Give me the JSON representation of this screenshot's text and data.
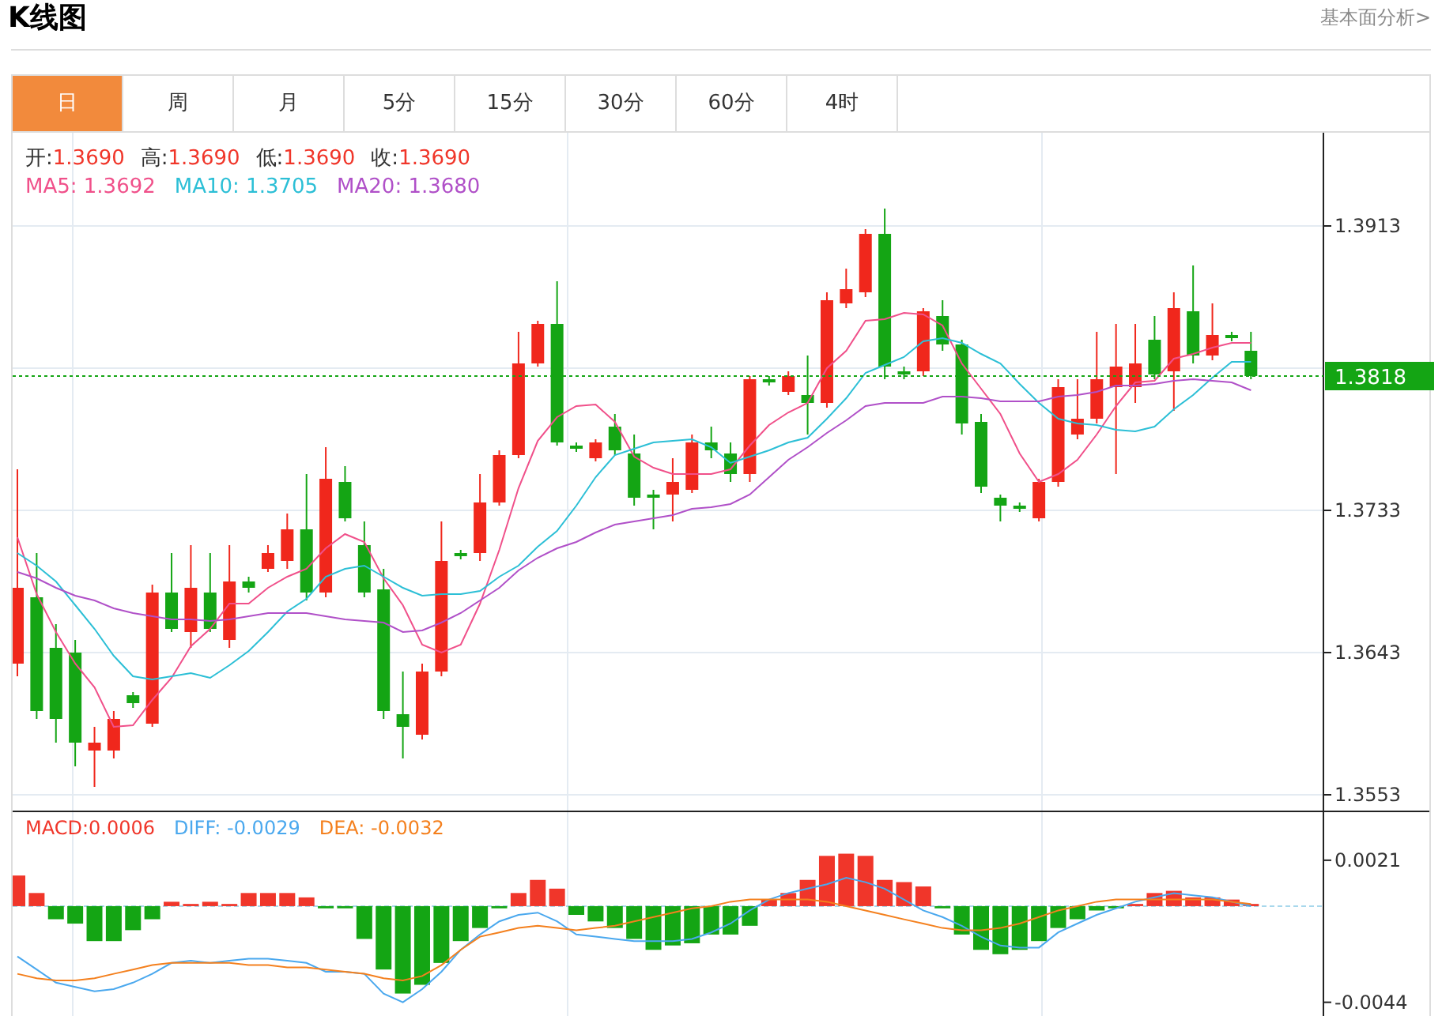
{
  "header": {
    "title": "K线图",
    "link": "基本面分析>"
  },
  "tabs": [
    {
      "label": "日",
      "selected": true
    },
    {
      "label": "周",
      "selected": false
    },
    {
      "label": "月",
      "selected": false
    },
    {
      "label": "5分",
      "selected": false
    },
    {
      "label": "15分",
      "selected": false
    },
    {
      "label": "30分",
      "selected": false
    },
    {
      "label": "60分",
      "selected": false
    },
    {
      "label": "4时",
      "selected": false
    }
  ],
  "quote": [
    {
      "label": "开:",
      "value": "1.3690"
    },
    {
      "label": "高:",
      "value": "1.3690"
    },
    {
      "label": "低:",
      "value": "1.3690"
    },
    {
      "label": "收:",
      "value": "1.3690"
    }
  ],
  "ma_legend": [
    {
      "label": "MA5: 1.3692",
      "color": "#f0508a"
    },
    {
      "label": "MA10: 1.3705",
      "color": "#2cbfd6"
    },
    {
      "label": "MA20: 1.3680",
      "color": "#b050c8"
    }
  ],
  "price_chart": {
    "chart_data": {
      "type": "candlestick",
      "categories": [
        null,
        null,
        null,
        null,
        null,
        null,
        null,
        null,
        null,
        null,
        null,
        null,
        null,
        null,
        null,
        null,
        null,
        null,
        null,
        null,
        null,
        null,
        null,
        null,
        null,
        null,
        null,
        null,
        null,
        null,
        null,
        null,
        null,
        null,
        null,
        null,
        null,
        null,
        null,
        null,
        null,
        null,
        null,
        null,
        null,
        null,
        null,
        null,
        null,
        null,
        null,
        null,
        null,
        null,
        null,
        null,
        null,
        null,
        null,
        null,
        null,
        null,
        null,
        null,
        null
      ],
      "yticks": [
        1.3913,
        1.3733,
        1.3643,
        1.3553
      ],
      "ylim": [
        1.3543,
        1.3972
      ],
      "grid": true,
      "ref_lines": [
        {
          "axis": "y",
          "value": 1.3818,
          "label": "1.3818",
          "color": "#14a514"
        }
      ],
      "ohlc": [
        [
          1.3636,
          1.3759,
          1.3628,
          1.3684
        ],
        [
          1.3678,
          1.3706,
          1.3601,
          1.3606
        ],
        [
          1.3646,
          1.3661,
          1.3586,
          1.3601
        ],
        [
          1.3643,
          1.3651,
          1.3571,
          1.3586
        ],
        [
          1.3581,
          1.3596,
          1.3558,
          1.3586
        ],
        [
          1.3581,
          1.3606,
          1.3576,
          1.3601
        ],
        [
          1.3616,
          1.3618,
          1.3608,
          1.3611
        ],
        [
          1.3598,
          1.3686,
          1.3596,
          1.3681
        ],
        [
          1.3681,
          1.3706,
          1.3656,
          1.3658
        ],
        [
          1.3656,
          1.3711,
          1.3646,
          1.3684
        ],
        [
          1.3681,
          1.3706,
          1.3656,
          1.3658
        ],
        [
          1.3651,
          1.3711,
          1.3646,
          1.3688
        ],
        [
          1.3688,
          1.3691,
          1.3681,
          1.3684
        ],
        [
          1.3696,
          1.3711,
          1.3694,
          1.3706
        ],
        [
          1.3701,
          1.3731,
          1.3696,
          1.3721
        ],
        [
          1.3721,
          1.3756,
          1.3676,
          1.3681
        ],
        [
          1.3681,
          1.3773,
          1.3678,
          1.3753
        ],
        [
          1.3751,
          1.3761,
          1.3726,
          1.3728
        ],
        [
          1.3711,
          1.3726,
          1.3678,
          1.3681
        ],
        [
          1.3683,
          1.3696,
          1.3601,
          1.3606
        ],
        [
          1.3604,
          1.3631,
          1.3576,
          1.3596
        ],
        [
          1.3591,
          1.3636,
          1.3588,
          1.3631
        ],
        [
          1.3631,
          1.3726,
          1.3628,
          1.3701
        ],
        [
          1.3706,
          1.3708,
          1.3702,
          1.3704
        ],
        [
          1.3706,
          1.3756,
          1.3701,
          1.3738
        ],
        [
          1.3738,
          1.3771,
          1.3736,
          1.3768
        ],
        [
          1.3768,
          1.3846,
          1.3766,
          1.3826
        ],
        [
          1.3826,
          1.3853,
          1.3824,
          1.3851
        ],
        [
          1.3851,
          1.3878,
          1.3774,
          1.3776
        ],
        [
          1.3774,
          1.3776,
          1.377,
          1.3772
        ],
        [
          1.3766,
          1.3778,
          1.3764,
          1.3776
        ],
        [
          1.3786,
          1.3794,
          1.3768,
          1.3771
        ],
        [
          1.3769,
          1.3781,
          1.3736,
          1.3741
        ],
        [
          1.3743,
          1.3746,
          1.3721,
          1.3741
        ],
        [
          1.3743,
          1.3766,
          1.3726,
          1.3751
        ],
        [
          1.3746,
          1.3781,
          1.3744,
          1.3776
        ],
        [
          1.3776,
          1.3786,
          1.3766,
          1.3771
        ],
        [
          1.3769,
          1.3776,
          1.3751,
          1.3756
        ],
        [
          1.3756,
          1.3818,
          1.3751,
          1.3816
        ],
        [
          1.3816,
          1.3818,
          1.3812,
          1.3814
        ],
        [
          1.3808,
          1.3821,
          1.3806,
          1.3818
        ],
        [
          1.3806,
          1.3831,
          1.3781,
          1.3801
        ],
        [
          1.3801,
          1.3871,
          1.3798,
          1.3866
        ],
        [
          1.3864,
          1.3886,
          1.3861,
          1.3873
        ],
        [
          1.3871,
          1.3911,
          1.3868,
          1.3908
        ],
        [
          1.3908,
          1.3924,
          1.3816,
          1.3824
        ],
        [
          1.3821,
          1.3824,
          1.3816,
          1.3819
        ],
        [
          1.3821,
          1.3861,
          1.3818,
          1.3859
        ],
        [
          1.3856,
          1.3866,
          1.3834,
          1.3838
        ],
        [
          1.3838,
          1.3841,
          1.3781,
          1.3788
        ],
        [
          1.3789,
          1.3794,
          1.3744,
          1.3748
        ],
        [
          1.3741,
          1.3743,
          1.3726,
          1.3736
        ],
        [
          1.3736,
          1.3738,
          1.3732,
          1.3734
        ],
        [
          1.3728,
          1.3753,
          1.3726,
          1.3751
        ],
        [
          1.3751,
          1.3816,
          1.3748,
          1.3811
        ],
        [
          1.3781,
          1.3816,
          1.3778,
          1.3791
        ],
        [
          1.3791,
          1.3846,
          1.3788,
          1.3816
        ],
        [
          1.3811,
          1.3851,
          1.3756,
          1.3824
        ],
        [
          1.3811,
          1.3851,
          1.3801,
          1.3826
        ],
        [
          1.3841,
          1.3856,
          1.3816,
          1.3819
        ],
        [
          1.3821,
          1.3871,
          1.3796,
          1.3861
        ],
        [
          1.3859,
          1.3888,
          1.3826,
          1.3831
        ],
        [
          1.3831,
          1.3864,
          1.3828,
          1.3844
        ],
        [
          1.3844,
          1.3846,
          1.384,
          1.3842
        ],
        [
          1.3834,
          1.3846,
          1.3816,
          1.3818
        ]
      ],
      "series": [
        {
          "type": "line",
          "color": "#f0508a",
          "values": [
            1.3716,
            1.368,
            1.3656,
            1.3636,
            1.3621,
            1.3596,
            1.3597,
            1.3613,
            1.3627,
            1.3647,
            1.3658,
            1.3674,
            1.3674,
            1.3684,
            1.3691,
            1.3696,
            1.3709,
            1.3718,
            1.3713,
            1.369,
            1.3673,
            1.3648,
            1.3643,
            1.3648,
            1.3674,
            1.3708,
            1.3747,
            1.3777,
            1.3792,
            1.3799,
            1.38,
            1.3789,
            1.3767,
            1.376,
            1.3756,
            1.3756,
            1.3756,
            1.3759,
            1.3774,
            1.3787,
            1.3795,
            1.3801,
            1.3823,
            1.3834,
            1.3853,
            1.3854,
            1.3858,
            1.3857,
            1.385,
            1.3826,
            1.381,
            1.3794,
            1.3769,
            1.3751,
            1.3756,
            1.3765,
            1.3781,
            1.3799,
            1.3814,
            1.3815,
            1.3829,
            1.3832,
            1.3836,
            1.3839,
            1.3839
          ]
        },
        {
          "type": "line",
          "color": "#2cbfd6",
          "values": [
            1.3706,
            1.3698,
            1.3688,
            1.3673,
            1.3658,
            1.3641,
            1.3628,
            1.3626,
            1.3628,
            1.363,
            1.3627,
            1.3635,
            1.3644,
            1.3656,
            1.3669,
            1.3677,
            1.3691,
            1.3696,
            1.3698,
            1.3691,
            1.3684,
            1.3679,
            1.368,
            1.368,
            1.3682,
            1.3691,
            1.3698,
            1.371,
            1.372,
            1.3736,
            1.3754,
            1.3768,
            1.3772,
            1.3776,
            1.3777,
            1.3778,
            1.3773,
            1.3763,
            1.3767,
            1.3771,
            1.3776,
            1.3779,
            1.3791,
            1.3804,
            1.382,
            1.3825,
            1.383,
            1.384,
            1.3842,
            1.3839,
            1.3832,
            1.3826,
            1.3813,
            1.3801,
            1.3791,
            1.3788,
            1.3787,
            1.3784,
            1.3783,
            1.3786,
            1.3797,
            1.3806,
            1.3817,
            1.3827,
            1.3827
          ]
        },
        {
          "type": "line",
          "color": "#b050c8",
          "values": [
            1.3694,
            1.369,
            1.3684,
            1.3679,
            1.3676,
            1.3671,
            1.3668,
            1.3666,
            1.3664,
            1.3664,
            1.3663,
            1.3664,
            1.3666,
            1.3668,
            1.3668,
            1.3668,
            1.3666,
            1.3664,
            1.3663,
            1.3662,
            1.3656,
            1.3657,
            1.3662,
            1.3668,
            1.3676,
            1.3684,
            1.3695,
            1.3703,
            1.3709,
            1.3713,
            1.3719,
            1.3724,
            1.3726,
            1.3728,
            1.373,
            1.3734,
            1.3735,
            1.3737,
            1.3743,
            1.3754,
            1.3765,
            1.3773,
            1.3782,
            1.379,
            1.3799,
            1.3801,
            1.3801,
            1.3801,
            1.3805,
            1.3805,
            1.3804,
            1.3802,
            1.3802,
            1.3802,
            1.3805,
            1.3806,
            1.3808,
            1.3812,
            1.3812,
            1.3813,
            1.3815,
            1.3816,
            1.3815,
            1.3814,
            1.3809
          ]
        }
      ]
    }
  },
  "macd_chart": {
    "legend": [
      {
        "label": "MACD:0.0006",
        "color": "#f0362a"
      },
      {
        "label": "DIFF: -0.0029",
        "color": "#4aa8ee"
      },
      {
        "label": "DEA: -0.0032",
        "color": "#f4801e"
      }
    ],
    "chart_data": {
      "type": "bar",
      "categories": [
        null,
        null,
        null,
        null,
        null,
        null,
        null,
        null,
        null,
        null,
        null,
        null,
        null,
        null,
        null,
        null,
        null,
        null,
        null,
        null,
        null,
        null,
        null,
        null,
        null,
        null,
        null,
        null,
        null,
        null,
        null,
        null,
        null,
        null,
        null,
        null,
        null,
        null,
        null,
        null,
        null,
        null,
        null,
        null,
        null,
        null,
        null,
        null,
        null,
        null,
        null,
        null,
        null,
        null,
        null,
        null,
        null,
        null,
        null,
        null,
        null,
        null,
        null,
        null,
        null
      ],
      "yticks": [
        {
          "value": 0.0021,
          "label": "0.0021"
        },
        {
          "value": -0.0044,
          "label": "-0.0044"
        }
      ],
      "ylim": [
        -0.0051,
        0.0043
      ],
      "grid": true,
      "ref_lines": [
        {
          "axis": "y",
          "value": 0,
          "color": "#a8d8ec"
        }
      ],
      "series": [
        {
          "color": "#f0362a",
          "values": [
            0.0014,
            0.0006,
            null,
            null,
            null,
            null,
            null,
            null,
            0.0002,
            0.0001,
            0.0002,
            0.0001,
            0.0006,
            0.0006,
            0.0006,
            0.0004,
            null,
            null,
            null,
            null,
            null,
            null,
            null,
            null,
            null,
            null,
            0.0006,
            0.0012,
            0.0008,
            null,
            null,
            null,
            null,
            null,
            null,
            null,
            null,
            null,
            null,
            0.0003,
            0.0006,
            0.0012,
            0.0023,
            0.0024,
            0.0023,
            0.0012,
            0.0011,
            0.0009,
            null,
            null,
            null,
            null,
            null,
            null,
            null,
            null,
            null,
            null,
            0.0001,
            0.0006,
            0.0007,
            0.0004,
            0.0004,
            0.0003,
            0.0001
          ]
        },
        {
          "color": "#14a514",
          "values": [
            null,
            null,
            -0.0006,
            -0.0008,
            -0.0016,
            -0.0016,
            -0.0011,
            -0.0006,
            null,
            null,
            null,
            null,
            null,
            null,
            null,
            null,
            -0.0001,
            -0.0001,
            -0.0015,
            -0.0029,
            -0.004,
            -0.0036,
            -0.0026,
            -0.0016,
            -0.001,
            -0.0001,
            null,
            null,
            null,
            -0.0004,
            -0.0007,
            -0.001,
            -0.0015,
            -0.002,
            -0.0018,
            -0.0017,
            -0.0013,
            -0.0013,
            -0.0009,
            null,
            null,
            null,
            null,
            null,
            null,
            null,
            null,
            null,
            -0.0001,
            -0.0013,
            -0.002,
            -0.0022,
            -0.002,
            -0.0016,
            -0.001,
            -0.0006,
            -0.0002,
            -0.0001,
            null,
            null,
            null,
            null,
            null,
            null,
            null
          ]
        },
        {
          "type": "line",
          "color": "#4aa8ee",
          "values": [
            -0.0023,
            -0.0029,
            -0.0035,
            -0.0037,
            -0.0039,
            -0.0038,
            -0.0035,
            -0.0031,
            -0.0026,
            -0.0025,
            -0.0026,
            -0.0025,
            -0.0024,
            -0.0024,
            -0.0025,
            -0.0026,
            -0.003,
            -0.003,
            -0.0031,
            -0.004,
            -0.0044,
            -0.0038,
            -0.003,
            -0.002,
            -0.0013,
            -0.0007,
            -0.0004,
            -0.0003,
            -0.0007,
            -0.0013,
            -0.0014,
            -0.0015,
            -0.0016,
            -0.0016,
            -0.0016,
            -0.0015,
            -0.0012,
            -0.0008,
            -0.0002,
            0.0003,
            0.0006,
            0.0008,
            0.001,
            0.0013,
            0.0011,
            0.0008,
            0.0003,
            -0.0002,
            -0.0005,
            -0.0009,
            -0.0014,
            -0.0018,
            -0.0019,
            -0.0019,
            -0.0012,
            -0.0008,
            -0.0004,
            -0.0001,
            0.0002,
            0.0004,
            0.0006,
            0.0005,
            0.0004,
            0.0002,
            0.0
          ]
        },
        {
          "type": "line",
          "color": "#f4801e",
          "values": [
            -0.0031,
            -0.0033,
            -0.0034,
            -0.0034,
            -0.0033,
            -0.0031,
            -0.0029,
            -0.0027,
            -0.0026,
            -0.0026,
            -0.0026,
            -0.0026,
            -0.0027,
            -0.0027,
            -0.0028,
            -0.0028,
            -0.0029,
            -0.003,
            -0.0031,
            -0.0033,
            -0.0034,
            -0.0032,
            -0.0027,
            -0.002,
            -0.0014,
            -0.0012,
            -0.001,
            -0.0009,
            -0.001,
            -0.0011,
            -0.001,
            -0.0009,
            -0.0007,
            -0.0005,
            -0.0003,
            -0.0001,
            0.0,
            0.0002,
            0.0003,
            0.0003,
            0.0003,
            0.0003,
            0.0002,
            0.0,
            -0.0002,
            -0.0004,
            -0.0006,
            -0.0008,
            -0.001,
            -0.0011,
            -0.0011,
            -0.001,
            -0.0008,
            -0.0005,
            -0.0002,
            0.0,
            0.0002,
            0.0003,
            0.0003,
            0.0003,
            0.0003,
            0.0003,
            0.0003,
            0.0002,
            0.0001
          ]
        }
      ]
    }
  }
}
